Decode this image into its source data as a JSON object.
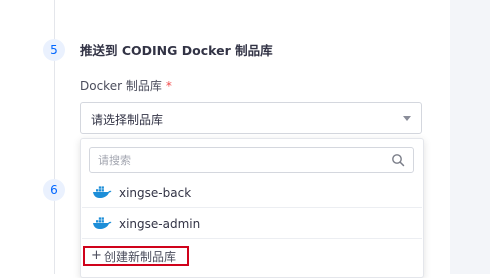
{
  "step5": {
    "number": "5",
    "title": "推送到 CODING Docker 制品库"
  },
  "field": {
    "label": "Docker 制品库",
    "required_mark": "*"
  },
  "select": {
    "value": "请选择制品库"
  },
  "step6": {
    "number": "6",
    "label_partial": "ì"
  },
  "dropdown": {
    "search_placeholder": "请搜索",
    "options": [
      {
        "label": "xingse-back",
        "icon": "docker-icon"
      },
      {
        "label": "xingse-admin",
        "icon": "docker-icon"
      }
    ],
    "create_plus": "+",
    "create_label": "创建新制品库"
  },
  "colors": {
    "accent": "#0066ff",
    "step_circle_bg": "#eaf1fe",
    "required": "#f24c4c",
    "highlight_border": "#d0021b",
    "docker_blue": "#1d8ed8"
  }
}
